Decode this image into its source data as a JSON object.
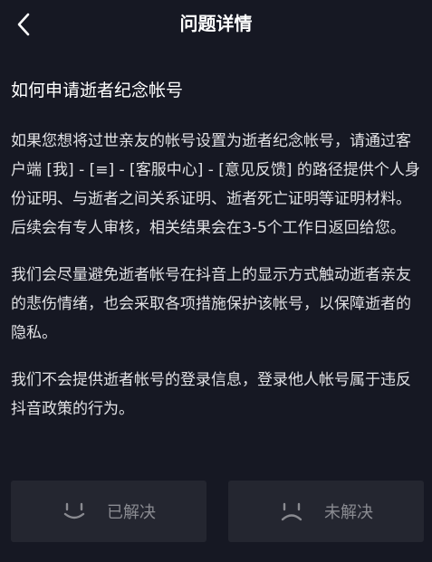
{
  "nav": {
    "title": "问题详情"
  },
  "article": {
    "title": "如何申请逝者纪念帐号",
    "paragraphs": [
      "如果您想将过世亲友的帐号设置为逝者纪念帐号，请通过客户端 [我] - [≡] - [客服中心] - [意见反馈] 的路径提供个人身份证明、与逝者之间关系证明、逝者死亡证明等证明材料。后续会有专人审核，相关结果会在3-5个工作日返回给您。",
      "我们会尽量避免逝者帐号在抖音上的显示方式触动逝者亲友的悲伤情绪，也会采取各项措施保护该帐号，以保障逝者的隐私。",
      "我们不会提供逝者帐号的登录信息，登录他人帐号属于违反抖音政策的行为。"
    ]
  },
  "feedback": {
    "solved_label": "已解决",
    "unsolved_label": "未解决"
  },
  "colors": {
    "background": "#161823",
    "button_bg": "#242630",
    "muted_text": "#8a8b91"
  },
  "icons": {
    "back": "chevron-left-icon",
    "solved": "smile-face-icon",
    "unsolved": "frown-face-icon"
  }
}
